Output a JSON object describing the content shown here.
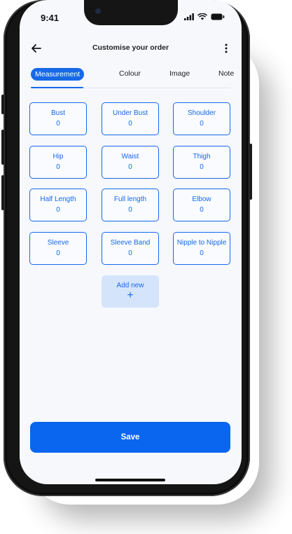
{
  "status_bar": {
    "time": "9:41"
  },
  "header": {
    "title": "Customise your order"
  },
  "tabs": [
    {
      "label": "Measurement",
      "active": true
    },
    {
      "label": "Colour",
      "active": false
    },
    {
      "label": "Image",
      "active": false
    },
    {
      "label": "Note",
      "active": false
    }
  ],
  "measurements": [
    {
      "label": "Bust",
      "value": "0"
    },
    {
      "label": "Under Bust",
      "value": "0"
    },
    {
      "label": "Shoulder",
      "value": "0"
    },
    {
      "label": "Hip",
      "value": "0"
    },
    {
      "label": "Waist",
      "value": "0"
    },
    {
      "label": "Thigh",
      "value": "0"
    },
    {
      "label": "Half Length",
      "value": "0"
    },
    {
      "label": "Full length",
      "value": "0"
    },
    {
      "label": "Elbow",
      "value": "0"
    },
    {
      "label": "Sleeve",
      "value": "0"
    },
    {
      "label": "Sleeve Band",
      "value": "0"
    },
    {
      "label": "Nipple to Nipple",
      "value": "0"
    }
  ],
  "add_new": {
    "label": "Add new",
    "icon": "+"
  },
  "save_button": {
    "label": "Save"
  },
  "colors": {
    "accent": "#1769e8",
    "save_bg": "#0b66ef",
    "add_new_bg": "#d4e4fb"
  }
}
